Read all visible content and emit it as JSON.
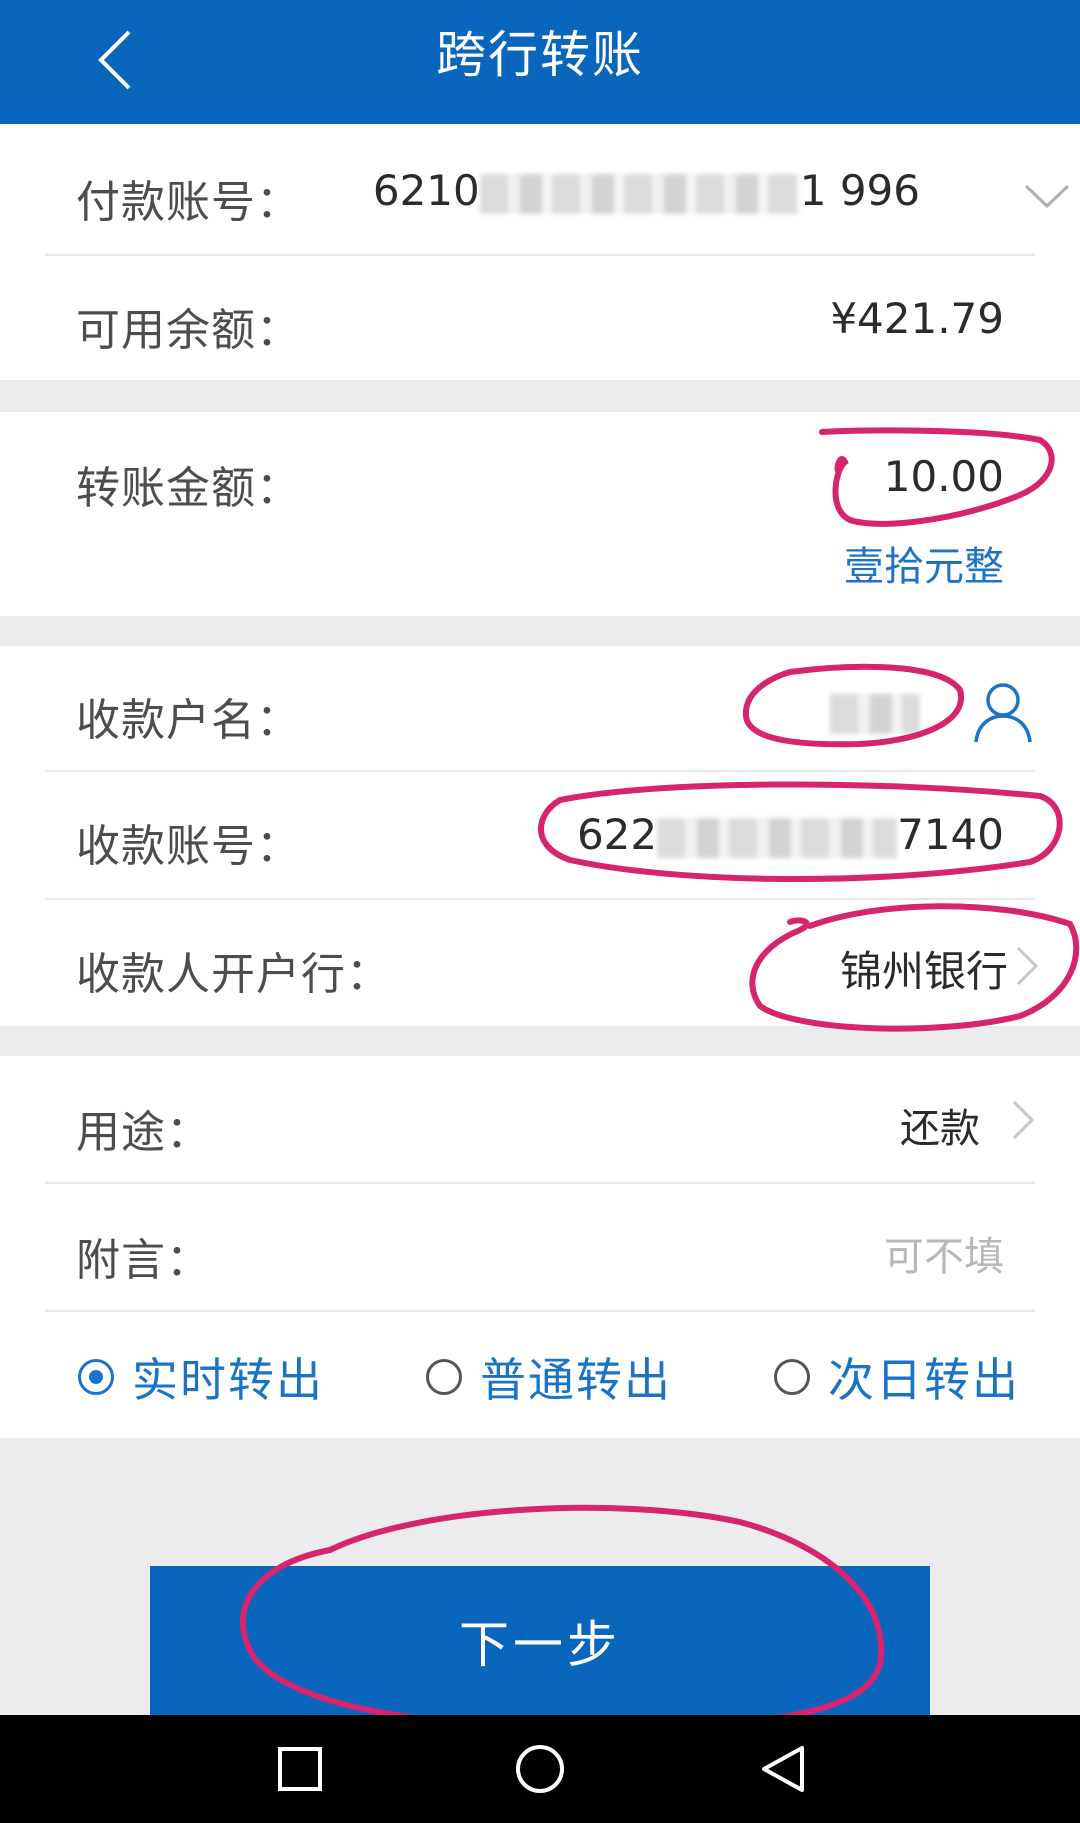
{
  "header": {
    "title": "跨行转账",
    "back_icon": "chevron-left-icon"
  },
  "payer": {
    "account_label": "付款账号：",
    "account_prefix": "6210",
    "account_suffix": "1 996",
    "balance_label": "可用余额：",
    "balance_value": "¥421.79"
  },
  "amount": {
    "label": "转账金额：",
    "value": "10.00",
    "chinese": "壹拾元整"
  },
  "payee": {
    "name_label": "收款户名：",
    "account_label": "收款账号：",
    "account_prefix": "622",
    "account_suffix": "7140",
    "bank_label": "收款人开户行：",
    "bank_value": "锦州银行"
  },
  "extra": {
    "purpose_label": "用途：",
    "purpose_value": "还款",
    "memo_label": "附言：",
    "memo_placeholder": "可不填"
  },
  "transfer_types": [
    {
      "label": "实时转出",
      "selected": true
    },
    {
      "label": "普通转出",
      "selected": false
    },
    {
      "label": "次日转出",
      "selected": false
    }
  ],
  "next_button": "下一步",
  "colors": {
    "primary": "#0a66bc",
    "accent_text": "#1a73c6",
    "annotation": "#d6246e",
    "background": "#ececee"
  }
}
